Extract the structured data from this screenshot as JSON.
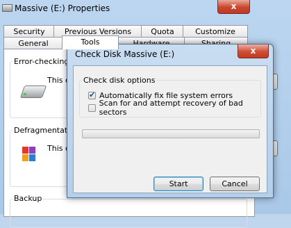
{
  "properties_window": {
    "title": "Massive (E:) Properties",
    "close_glyph": "x",
    "tabs_row1": [
      "Security",
      "Previous Versions",
      "Quota",
      "Customize"
    ],
    "tabs_row2": [
      "General",
      "Tools",
      "Hardware",
      "Sharing"
    ],
    "active_tab": "Tools",
    "error_checking": {
      "label": "Error-checking",
      "text": "This op"
    },
    "defragmentation": {
      "label": "Defragmentation",
      "text": "This op"
    },
    "backup": {
      "label": "Backup"
    }
  },
  "check_disk_dialog": {
    "title": "Check Disk Massive (E:)",
    "close_glyph": "x",
    "group_label": "Check disk options",
    "options": [
      {
        "label": "Automatically fix file system errors",
        "checked": true
      },
      {
        "label": "Scan for and attempt recovery of bad sectors",
        "checked": false
      }
    ],
    "progress": 0,
    "start_label": "Start",
    "cancel_label": "Cancel"
  },
  "icons": {
    "drive": "drive-icon",
    "defrag": "defrag-icon",
    "window": "drive-small-icon"
  },
  "colors": {
    "title_bar": "#bcd6f0",
    "close_red": "#c9462c",
    "dialog_body": "#f0f0f0"
  }
}
